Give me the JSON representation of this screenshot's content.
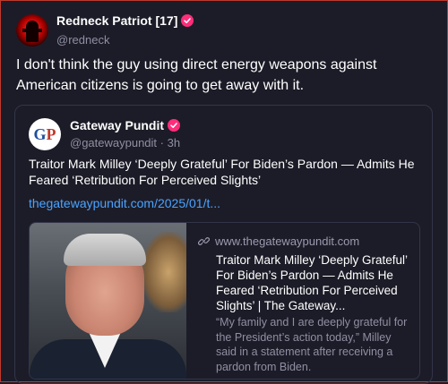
{
  "post": {
    "author_name": "Redneck Patriot [17]",
    "author_handle": "@redneck",
    "text": "I don't think the guy using direct energy weapons against American citizens is going to get away with it."
  },
  "quote": {
    "author_name": "Gateway Pundit",
    "author_handle": "@gatewaypundit · 3h",
    "logo_text_g": "G",
    "logo_text_p": "P",
    "text": "Traitor Mark Milley ‘Deeply Grateful’ For Biden’s Pardon — Admits He Feared ‘Retribution For Perceived Slights’",
    "link": "thegatewaypundit.com/2025/01/t..."
  },
  "link_card": {
    "domain": "www.thegatewaypundit.com",
    "title": "Traitor Mark Milley ‘Deeply Grateful’ For Biden’s Pardon — Admits He Feared ‘Retribution For Perceived Slights’ | The Gateway...",
    "description": "“My family and I are deeply grateful for the President’s action today,” Milley said in a statement after receiving a pardon from Biden."
  },
  "colors": {
    "background": "#1c1c28",
    "verified_badge": "#ff2d7a",
    "link": "#4aa3ff",
    "muted_text": "#8f8fa3"
  },
  "icons": {
    "verified": "verified-badge-icon",
    "link": "link-icon"
  }
}
